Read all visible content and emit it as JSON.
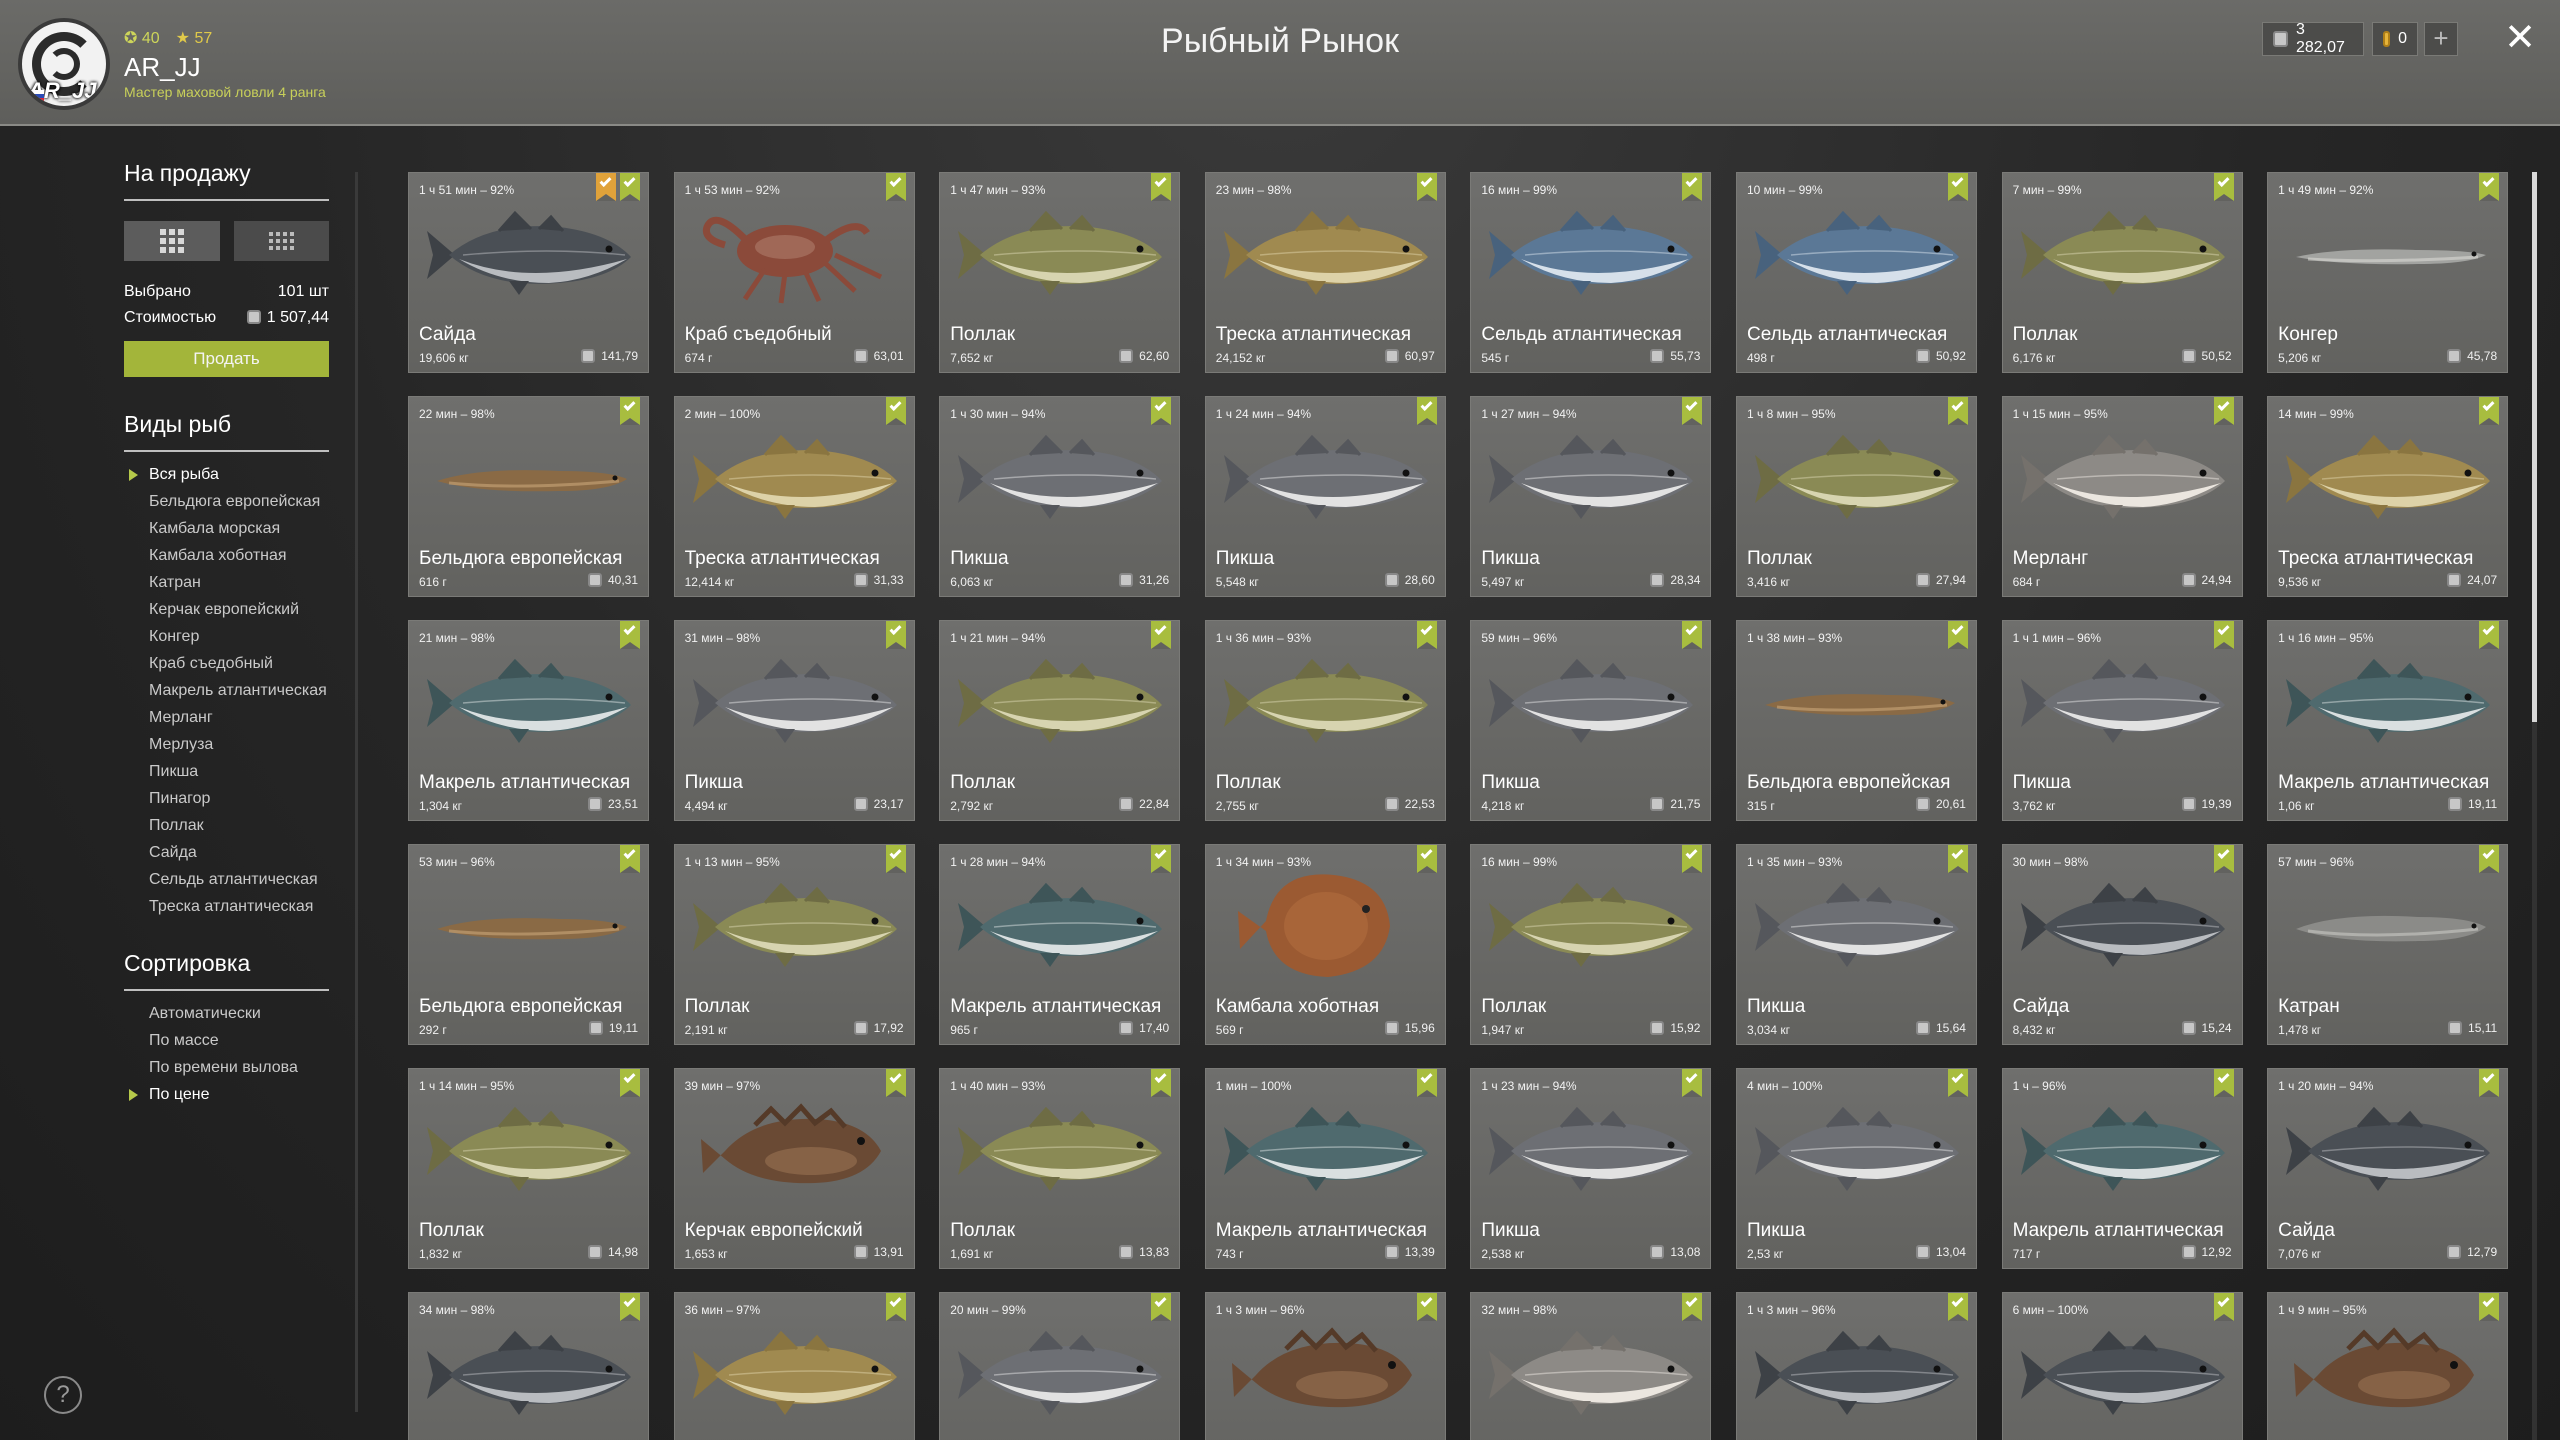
{
  "header": {
    "title": "Рыбный Рынок",
    "stat_level": "40",
    "stat_stars": "57",
    "username": "AR_JJ",
    "avatar_tag": "AR_JJ",
    "rank": "Мастер маховой ловли 4 ранга",
    "silver": "3 282,07",
    "gold": "0",
    "plus": "+",
    "close": "✕"
  },
  "sidebar": {
    "for_sale_title": "На продажу",
    "selected_label": "Выбрано",
    "selected_value": "101 шт",
    "cost_label": "Стоимостью",
    "cost_value": "1 507,44",
    "sell_button": "Продать",
    "species_title": "Виды рыб",
    "species": [
      "Вся рыба",
      "Бельдюга европейская",
      "Камбала морская",
      "Камбала хоботная",
      "Катран",
      "Керчак европейский",
      "Конгер",
      "Краб съедобный",
      "Макрель атлантическая",
      "Мерланг",
      "Мерлуза",
      "Пикша",
      "Пинагор",
      "Поллак",
      "Сайда",
      "Сельдь атлантическая",
      "Треска атлантическая"
    ],
    "sort_title": "Сортировка",
    "sort_options": [
      "Автоматически",
      "По массе",
      "По времени вылова",
      "По цене"
    ],
    "help": "?"
  },
  "colors": {
    "accent": "#a8bd3f",
    "card_bg": "#6a6a67",
    "header_bg": "#646461"
  },
  "cards": [
    {
      "time": "1 ч 51 мин – 92%",
      "name": "Сайда",
      "weight": "19,606 кг",
      "price": "141,79",
      "fish": "saithe",
      "bm2": true
    },
    {
      "time": "1 ч 53 мин – 92%",
      "name": "Краб съедобный",
      "weight": "674 г",
      "price": "63,01",
      "fish": "crab"
    },
    {
      "time": "1 ч 47 мин – 93%",
      "name": "Поллак",
      "weight": "7,652 кг",
      "price": "62,60",
      "fish": "pollack"
    },
    {
      "time": "23 мин – 98%",
      "name": "Треска атлантическая",
      "weight": "24,152 кг",
      "price": "60,97",
      "fish": "cod"
    },
    {
      "time": "16 мин – 99%",
      "name": "Сельдь атлантическая",
      "weight": "545 г",
      "price": "55,73",
      "fish": "herring"
    },
    {
      "time": "10 мин – 99%",
      "name": "Сельдь атлантическая",
      "weight": "498 г",
      "price": "50,92",
      "fish": "herring"
    },
    {
      "time": "7 мин – 99%",
      "name": "Поллак",
      "weight": "6,176 кг",
      "price": "50,52",
      "fish": "pollack"
    },
    {
      "time": "1 ч 49 мин – 92%",
      "name": "Конгер",
      "weight": "5,206 кг",
      "price": "45,78",
      "fish": "conger"
    },
    {
      "time": "22 мин – 98%",
      "name": "Бельдюга европейская",
      "weight": "616 г",
      "price": "40,31",
      "fish": "eelpout"
    },
    {
      "time": "2 мин – 100%",
      "name": "Треска атлантическая",
      "weight": "12,414 кг",
      "price": "31,33",
      "fish": "cod"
    },
    {
      "time": "1 ч 30 мин – 94%",
      "name": "Пикша",
      "weight": "6,063 кг",
      "price": "31,26",
      "fish": "haddock"
    },
    {
      "time": "1 ч 24 мин – 94%",
      "name": "Пикша",
      "weight": "5,548 кг",
      "price": "28,60",
      "fish": "haddock"
    },
    {
      "time": "1 ч 27 мин – 94%",
      "name": "Пикша",
      "weight": "5,497 кг",
      "price": "28,34",
      "fish": "haddock"
    },
    {
      "time": "1 ч 8 мин – 95%",
      "name": "Поллак",
      "weight": "3,416 кг",
      "price": "27,94",
      "fish": "pollack"
    },
    {
      "time": "1 ч 15 мин – 95%",
      "name": "Мерланг",
      "weight": "684 г",
      "price": "24,94",
      "fish": "whiting"
    },
    {
      "time": "14 мин – 99%",
      "name": "Треска атлантическая",
      "weight": "9,536 кг",
      "price": "24,07",
      "fish": "cod"
    },
    {
      "time": "21 мин – 98%",
      "name": "Макрель атлантическая",
      "weight": "1,304 кг",
      "price": "23,51",
      "fish": "mackerel"
    },
    {
      "time": "31 мин – 98%",
      "name": "Пикша",
      "weight": "4,494 кг",
      "price": "23,17",
      "fish": "haddock"
    },
    {
      "time": "1 ч 21 мин – 94%",
      "name": "Поллак",
      "weight": "2,792 кг",
      "price": "22,84",
      "fish": "pollack"
    },
    {
      "time": "1 ч 36 мин – 93%",
      "name": "Поллак",
      "weight": "2,755 кг",
      "price": "22,53",
      "fish": "pollack"
    },
    {
      "time": "59 мин – 96%",
      "name": "Пикша",
      "weight": "4,218 кг",
      "price": "21,75",
      "fish": "haddock"
    },
    {
      "time": "1 ч 38 мин – 93%",
      "name": "Бельдюга европейская",
      "weight": "315 г",
      "price": "20,61",
      "fish": "eelpout"
    },
    {
      "time": "1 ч 1 мин – 96%",
      "name": "Пикша",
      "weight": "3,762 кг",
      "price": "19,39",
      "fish": "haddock"
    },
    {
      "time": "1 ч 16 мин – 95%",
      "name": "Макрель атлантическая",
      "weight": "1,06 кг",
      "price": "19,11",
      "fish": "mackerel"
    },
    {
      "time": "53 мин – 96%",
      "name": "Бельдюга европейская",
      "weight": "292 г",
      "price": "19,11",
      "fish": "eelpout"
    },
    {
      "time": "1 ч 13 мин – 95%",
      "name": "Поллак",
      "weight": "2,191 кг",
      "price": "17,92",
      "fish": "pollack"
    },
    {
      "time": "1 ч 28 мин – 94%",
      "name": "Макрель атлантическая",
      "weight": "965 г",
      "price": "17,40",
      "fish": "mackerel"
    },
    {
      "time": "1 ч 34 мин – 93%",
      "name": "Камбала хоботная",
      "weight": "569 г",
      "price": "15,96",
      "fish": "flounder"
    },
    {
      "time": "16 мин – 99%",
      "name": "Поллак",
      "weight": "1,947 кг",
      "price": "15,92",
      "fish": "pollack"
    },
    {
      "time": "1 ч 35 мин – 93%",
      "name": "Пикша",
      "weight": "3,034 кг",
      "price": "15,64",
      "fish": "haddock"
    },
    {
      "time": "30 мин – 98%",
      "name": "Сайда",
      "weight": "8,432 кг",
      "price": "15,24",
      "fish": "saithe"
    },
    {
      "time": "57 мин – 96%",
      "name": "Катран",
      "weight": "1,478 кг",
      "price": "15,11",
      "fish": "dogfish"
    },
    {
      "time": "1 ч 14 мин – 95%",
      "name": "Поллак",
      "weight": "1,832 кг",
      "price": "14,98",
      "fish": "pollack"
    },
    {
      "time": "39 мин – 97%",
      "name": "Керчак европейский",
      "weight": "1,653 кг",
      "price": "13,91",
      "fish": "sculpin"
    },
    {
      "time": "1 ч 40 мин – 93%",
      "name": "Поллак",
      "weight": "1,691 кг",
      "price": "13,83",
      "fish": "pollack"
    },
    {
      "time": "1 мин – 100%",
      "name": "Макрель атлантическая",
      "weight": "743 г",
      "price": "13,39",
      "fish": "mackerel"
    },
    {
      "time": "1 ч 23 мин – 94%",
      "name": "Пикша",
      "weight": "2,538 кг",
      "price": "13,08",
      "fish": "haddock"
    },
    {
      "time": "4 мин – 100%",
      "name": "Пикша",
      "weight": "2,53 кг",
      "price": "13,04",
      "fish": "haddock"
    },
    {
      "time": "1 ч – 96%",
      "name": "Макрель атлантическая",
      "weight": "717 г",
      "price": "12,92",
      "fish": "mackerel"
    },
    {
      "time": "1 ч 20 мин – 94%",
      "name": "Сайда",
      "weight": "7,076 кг",
      "price": "12,79",
      "fish": "saithe"
    },
    {
      "time": "34 мин – 98%",
      "name": "",
      "weight": "",
      "price": "",
      "fish": "saithe"
    },
    {
      "time": "36 мин – 97%",
      "name": "",
      "weight": "",
      "price": "",
      "fish": "cod"
    },
    {
      "time": "20 мин – 99%",
      "name": "",
      "weight": "",
      "price": "",
      "fish": "haddock"
    },
    {
      "time": "1 ч 3 мин – 96%",
      "name": "",
      "weight": "",
      "price": "",
      "fish": "sculpin"
    },
    {
      "time": "32 мин – 98%",
      "name": "",
      "weight": "",
      "price": "",
      "fish": "whiting"
    },
    {
      "time": "1 ч 3 мин – 96%",
      "name": "",
      "weight": "",
      "price": "",
      "fish": "saithe"
    },
    {
      "time": "6 мин – 100%",
      "name": "",
      "weight": "",
      "price": "",
      "fish": "saithe"
    },
    {
      "time": "1 ч 9 мин – 95%",
      "name": "",
      "weight": "",
      "price": "",
      "fish": "sculpin"
    }
  ]
}
